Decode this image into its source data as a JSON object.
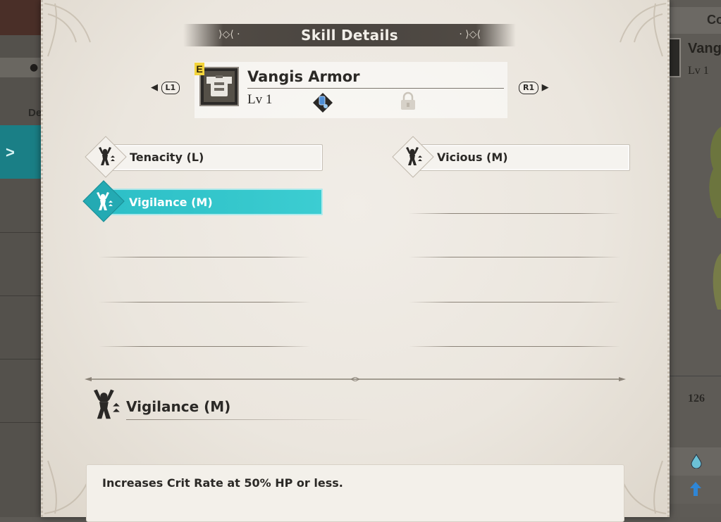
{
  "background": {
    "left_label": "De",
    "right_label": "Co",
    "right_armor_name": "Vang",
    "right_armor_level": "Lv 1",
    "right_number": "126"
  },
  "panel": {
    "title": "Skill Details",
    "nav_prev": "L1",
    "nav_next": "R1"
  },
  "armor": {
    "rank": "E",
    "name": "Vangis Armor",
    "level": "Lv 1",
    "icon": "chest-armor-icon",
    "slots": [
      {
        "icon": "decoration-slot-icon",
        "state": "filled"
      },
      {
        "icon": "lock-icon",
        "state": "locked"
      }
    ]
  },
  "skills": [
    {
      "label": "Tenacity (L)",
      "icon": "skill-flex-icon",
      "selected": false
    },
    {
      "label": "Vicious (M)",
      "icon": "skill-flex-icon",
      "selected": false
    },
    {
      "label": "Vigilance (M)",
      "icon": "skill-flex-icon",
      "selected": true
    }
  ],
  "detail": {
    "name": "Vigilance (M)",
    "icon": "skill-flex-icon",
    "description": "Increases Crit Rate at 50% HP or less."
  },
  "colors": {
    "selected": "#2dbfc7",
    "rank_badge": "#f3d43c",
    "title_bar": "#4a4540"
  }
}
